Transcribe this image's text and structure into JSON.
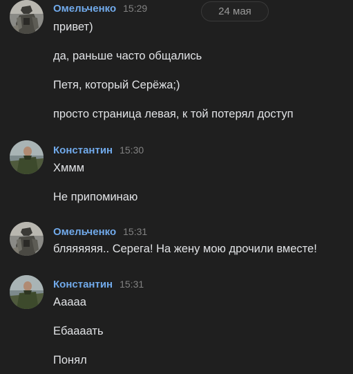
{
  "date_separator": "24 мая",
  "groups": [
    {
      "author": "Омельченко",
      "time": "15:29",
      "avatar_icon": "soldier-armor-avatar",
      "messages": [
        "привет)",
        "да, раньше часто общались",
        "Петя, который Серёжа;)",
        "просто страница левая, к той потерял доступ"
      ]
    },
    {
      "author": "Константин",
      "time": "15:30",
      "avatar_icon": "man-outdoors-avatar",
      "messages": [
        "Хммм",
        "Не припоминаю"
      ]
    },
    {
      "author": "Омельченко",
      "time": "15:31",
      "avatar_icon": "soldier-armor-avatar",
      "messages": [
        "бляяяяяя.. Серега! На жену мою дрочили вместе!"
      ]
    },
    {
      "author": "Константин",
      "time": "15:31",
      "avatar_icon": "man-outdoors-avatar",
      "messages": [
        "Ааааа",
        "Ебаааать",
        "Понял"
      ]
    }
  ],
  "colors": {
    "background": "#1f1f1f",
    "author": "#71aaeb",
    "time": "#828282",
    "text": "#e1e3e6"
  }
}
